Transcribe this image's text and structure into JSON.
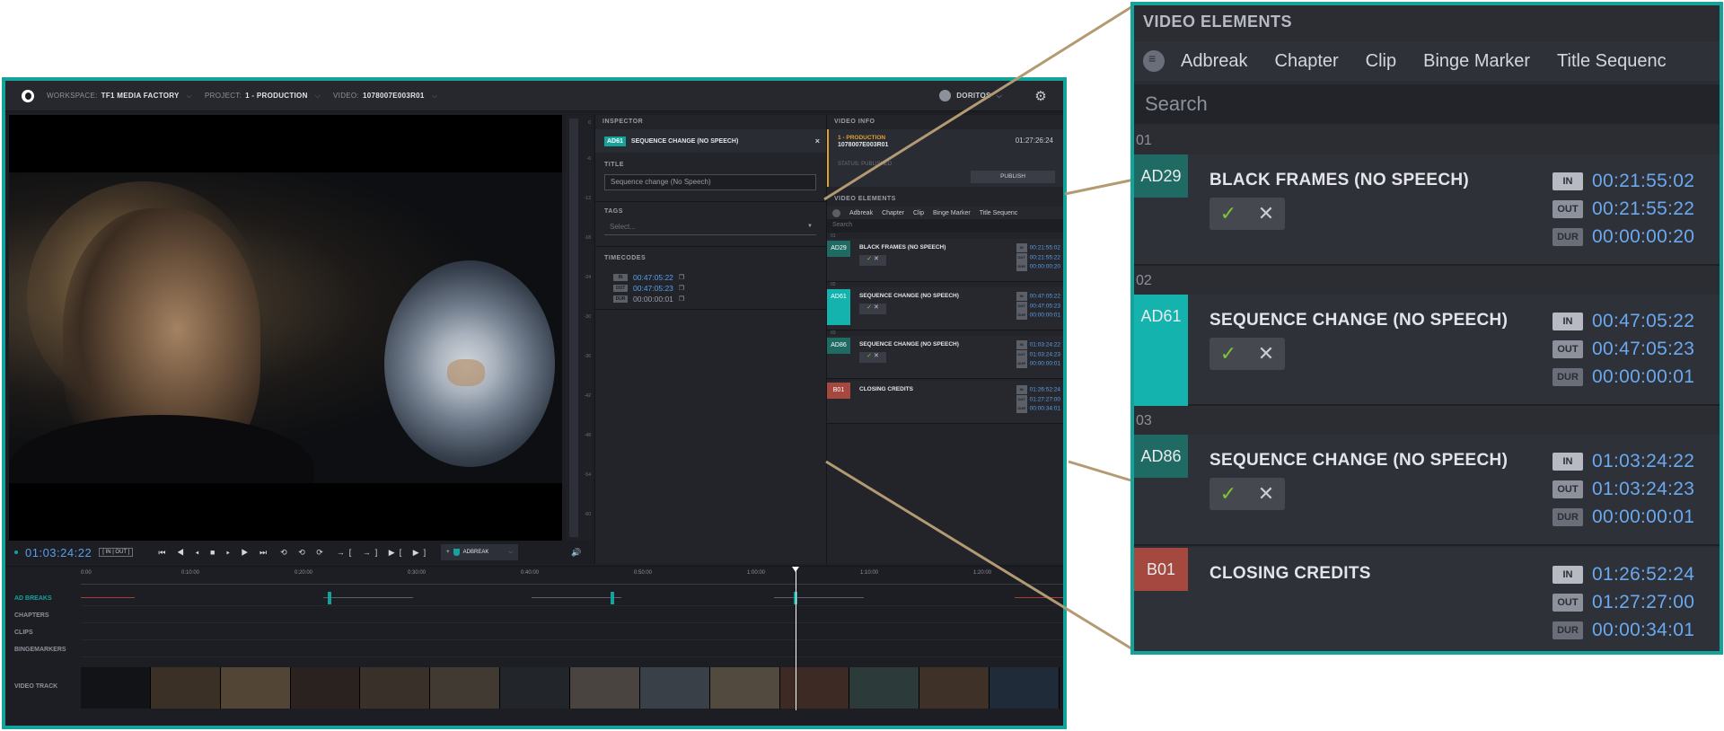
{
  "topbar": {
    "workspace_label": "WORKSPACE:",
    "workspace_value": "TF1 MEDIA FACTORY",
    "project_label": "PROJECT:",
    "project_value": "1 - PRODUCTION",
    "video_label": "VIDEO:",
    "video_value": "1078007E003R01",
    "user": "DORITOS"
  },
  "player": {
    "timecode": "01:03:24:22",
    "in_out": "[ IN | OUT ]",
    "controls": "⏮ ◀ ◂ ■ ▸ ▶ ⏭",
    "loop_controls": "⟲ ⟲ ⟳",
    "mark_controls": "→[ →] ▶[ ▶]",
    "adbreak_label": "ADBREAK",
    "add_label": "+",
    "volume": "🔊",
    "meter_ticks": [
      "0",
      "-6",
      "-12",
      "-18",
      "-24",
      "-30",
      "-36",
      "-42",
      "-48",
      "-54",
      "-60"
    ]
  },
  "inspector": {
    "header": "INSPECTOR",
    "selected_tag": "AD61",
    "selected_name": "SEQUENCE CHANGE (NO SPEECH)",
    "close": "×",
    "title_label": "TITLE",
    "title_value": "Sequence change (No Speech)",
    "tags_label": "TAGS",
    "tags_placeholder": "Select...",
    "timecodes_label": "TIMECODES",
    "in_key": "IN",
    "in_value": "00:47:05:22",
    "out_key": "OUT",
    "out_value": "00:47:05:23",
    "dur_key": "DUR",
    "dur_value": "00:00:00:01"
  },
  "video_info": {
    "header": "VIDEO INFO",
    "project": "1 - PRODUCTION",
    "video_id": "1078007E003R01",
    "duration": "01:27:26:24",
    "status": "STATUS: PUBLISHED",
    "publish": "PUBLISH"
  },
  "video_elements": {
    "header": "VIDEO ELEMENTS",
    "filters": [
      "Adbreak",
      "Chapter",
      "Clip",
      "Binge Marker",
      "Title Sequenc"
    ],
    "search_placeholder": "Search",
    "items": [
      {
        "section": "01",
        "tag": "AD29",
        "name": "BLACK FRAMES (NO SPEECH)",
        "in": "00:21:55:02",
        "out": "00:21:55:22",
        "dur": "00:00:00:20",
        "color": "#1f6b63"
      },
      {
        "section": "02",
        "tag": "AD61",
        "name": "SEQUENCE CHANGE (NO SPEECH)",
        "in": "00:47:05:22",
        "out": "00:47:05:23",
        "dur": "00:00:00:01",
        "color": "#14b3ad"
      },
      {
        "section": "03",
        "tag": "AD86",
        "name": "SEQUENCE CHANGE (NO SPEECH)",
        "in": "01:03:24:22",
        "out": "01:03:24:23",
        "dur": "00:00:00:01",
        "color": "#1f6b63"
      },
      {
        "section": "",
        "tag": "B01",
        "name": "CLOSING CREDITS",
        "in": "01:26:52:24",
        "out": "01:27:27:00",
        "dur": "00:00:34:01",
        "color": "#a5483f"
      }
    ],
    "keys": {
      "in": "IN",
      "out": "OUT",
      "dur": "DUR"
    },
    "check": "✓",
    "cross": "✕"
  },
  "timeline": {
    "ticks": [
      "0:00",
      "0:10:00",
      "0:20:00",
      "0:30:00",
      "0:40:00",
      "0:50:00",
      "1:00:00",
      "1:10:00",
      "1:20:00"
    ],
    "tracks": [
      "AD BREAKS",
      "CHAPTERS",
      "CLIPS",
      "BINGEMARKERS",
      "VIDEO TRACK"
    ]
  },
  "colors": {
    "accent": "#14a39a",
    "timecode": "#5a9ee8",
    "warning": "#e0a02f"
  }
}
